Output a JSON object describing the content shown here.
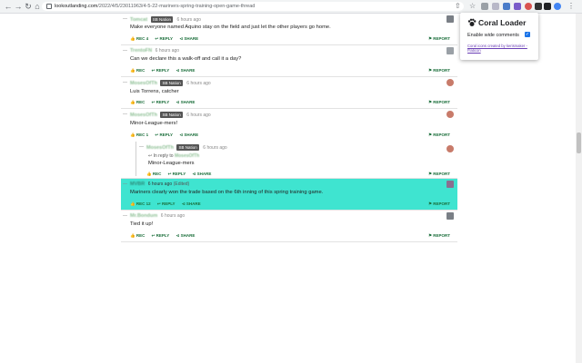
{
  "browser": {
    "url_host": "lookoutlanding.com",
    "url_path": "/2022/4/5/23011963/4-5-22-mariners-spring-training-open-game-thread"
  },
  "popup": {
    "title": "Coral Loader",
    "option_label": "Enable wide comments",
    "option_checked": true,
    "credit": "Coral icons created by kerismaker - Flaticon"
  },
  "labels": {
    "rec": "REC",
    "reply": "REPLY",
    "share": "SHARE",
    "report": "REPORT",
    "in_reply_to": "In reply to"
  },
  "comments": [
    {
      "author": "Tomcat",
      "badge": "SB Nation",
      "time": "6 hours ago",
      "text": "Make everyone named Aquino stay on the field and just let the other players go home.",
      "rec_count": "4",
      "avatar_color": "#7a7f86"
    },
    {
      "author": "TrentoFN",
      "badge": "",
      "time": "6 hours ago",
      "text": "Can we declare this a walk-off and call it a day?",
      "rec_count": "",
      "avatar_color": "#9aa0a6"
    },
    {
      "author": "MosesOfTh",
      "badge": "SB Nation",
      "time": "6 hours ago",
      "text": "Luis Torrens, catcher",
      "rec_count": "",
      "avatar_color": "#c87b6a"
    },
    {
      "author": "MosesOfTh",
      "badge": "SB Nation",
      "time": "6 hours ago",
      "text": "Minor-League-mers!",
      "rec_count": "1",
      "avatar_color": "#c87b6a"
    },
    {
      "author": "MosesOfTh",
      "badge": "SB Nation",
      "time": "6 hours ago",
      "text": "Minor-League-mers",
      "in_reply_to": "MosesOfTh",
      "rec_count": "",
      "avatar_color": "#c87b6a"
    },
    {
      "author": "MVBR",
      "badge": "",
      "time": "6 hours ago",
      "edited": "(Edited)",
      "text": "Mariners clearly won the trade based on the 6th inning of this spring training game.",
      "rec_count": "12",
      "avatar_color": "#8a6f8f"
    },
    {
      "author": "Mr.Bondum",
      "badge": "",
      "time": "6 hours ago",
      "text": "Tied it up!",
      "rec_count": "",
      "avatar_color": "#7a7f86"
    }
  ]
}
